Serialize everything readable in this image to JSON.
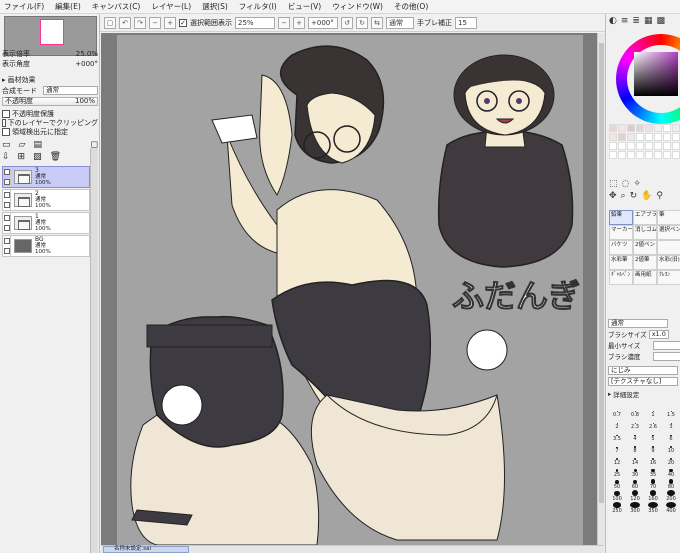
{
  "menu": [
    "ファイル(F)",
    "編集(E)",
    "キャンバス(C)",
    "レイヤー(L)",
    "選択(S)",
    "フィルタ(I)",
    "ビュー(V)",
    "ウィンドウ(W)",
    "その他(O)"
  ],
  "toolbar": {
    "selection_display_label": "選択範囲表示",
    "zoom": "25%",
    "rotation": "+000°",
    "blend_mode": "通常",
    "stabilizer_label": "手ブレ補正",
    "stabilizer_value": "15"
  },
  "left": {
    "zoom_label": "表示倍率",
    "zoom_value": "25.0%",
    "rotation_label": "表示角度",
    "rotation_value": "+000°",
    "paper_effect_label": "画材効果",
    "composite_mode_label": "合成モード",
    "composite_mode_value": "通常",
    "opacity_label": "不透明度",
    "opacity_value": "100%",
    "protect_opacity_label": "不透明度保護",
    "clip_label": "下のレイヤーでクリッピング",
    "specify_source_label": "領域検出元に指定",
    "layers": [
      {
        "name": "3",
        "mode": "通常",
        "opacity": "100%",
        "type": "folder"
      },
      {
        "name": "2",
        "mode": "通常",
        "opacity": "100%",
        "type": "folder"
      },
      {
        "name": "1",
        "mode": "通常",
        "opacity": "100%",
        "type": "folder"
      },
      {
        "name": "BG",
        "mode": "通常",
        "opacity": "100%",
        "type": "bg"
      }
    ]
  },
  "canvas": {
    "signature_text": "ふだんぎ",
    "file_tab": "名称未設定.sai"
  },
  "right": {
    "tools": [
      {
        "label": "鉛筆"
      },
      {
        "label": "エアブラシ"
      },
      {
        "label": "筆"
      },
      {
        "label": "マーカー"
      },
      {
        "label": "消しゴム"
      },
      {
        "label": "選択ペン"
      },
      {
        "label": "バケツ"
      },
      {
        "label": "2値ペン"
      },
      {
        "label": ""
      },
      {
        "label": "水彩筆"
      },
      {
        "label": "2値筆"
      },
      {
        "label": "水彩(旧)"
      },
      {
        "label": "ｷﾞｬﾙﾍﾟﾝ"
      },
      {
        "label": "画用紙"
      },
      {
        "label": "ｸﾚﾖﾝ"
      }
    ],
    "mode_label": "通常",
    "brush_size_label": "ブラシサイズ",
    "brush_size_mult": "x1.0",
    "min_size_label": "最小サイズ",
    "density_label": "ブラシ濃度",
    "texture_label": "にじみ",
    "texture_value": "[テクスチャなし]",
    "advanced_label": "詳細設定",
    "brush_sizes": [
      "0.7",
      "0.8",
      "1",
      "1.5",
      "2",
      "2.3",
      "2.6",
      "3",
      "3.5",
      "4",
      "5",
      "6",
      "7",
      "8",
      "9",
      "10",
      "12",
      "14",
      "16",
      "20",
      "25",
      "30",
      "35",
      "40",
      "50",
      "60",
      "70",
      "80",
      "100",
      "120",
      "160",
      "200",
      "250",
      "300",
      "350",
      "400",
      "450",
      "500"
    ]
  }
}
